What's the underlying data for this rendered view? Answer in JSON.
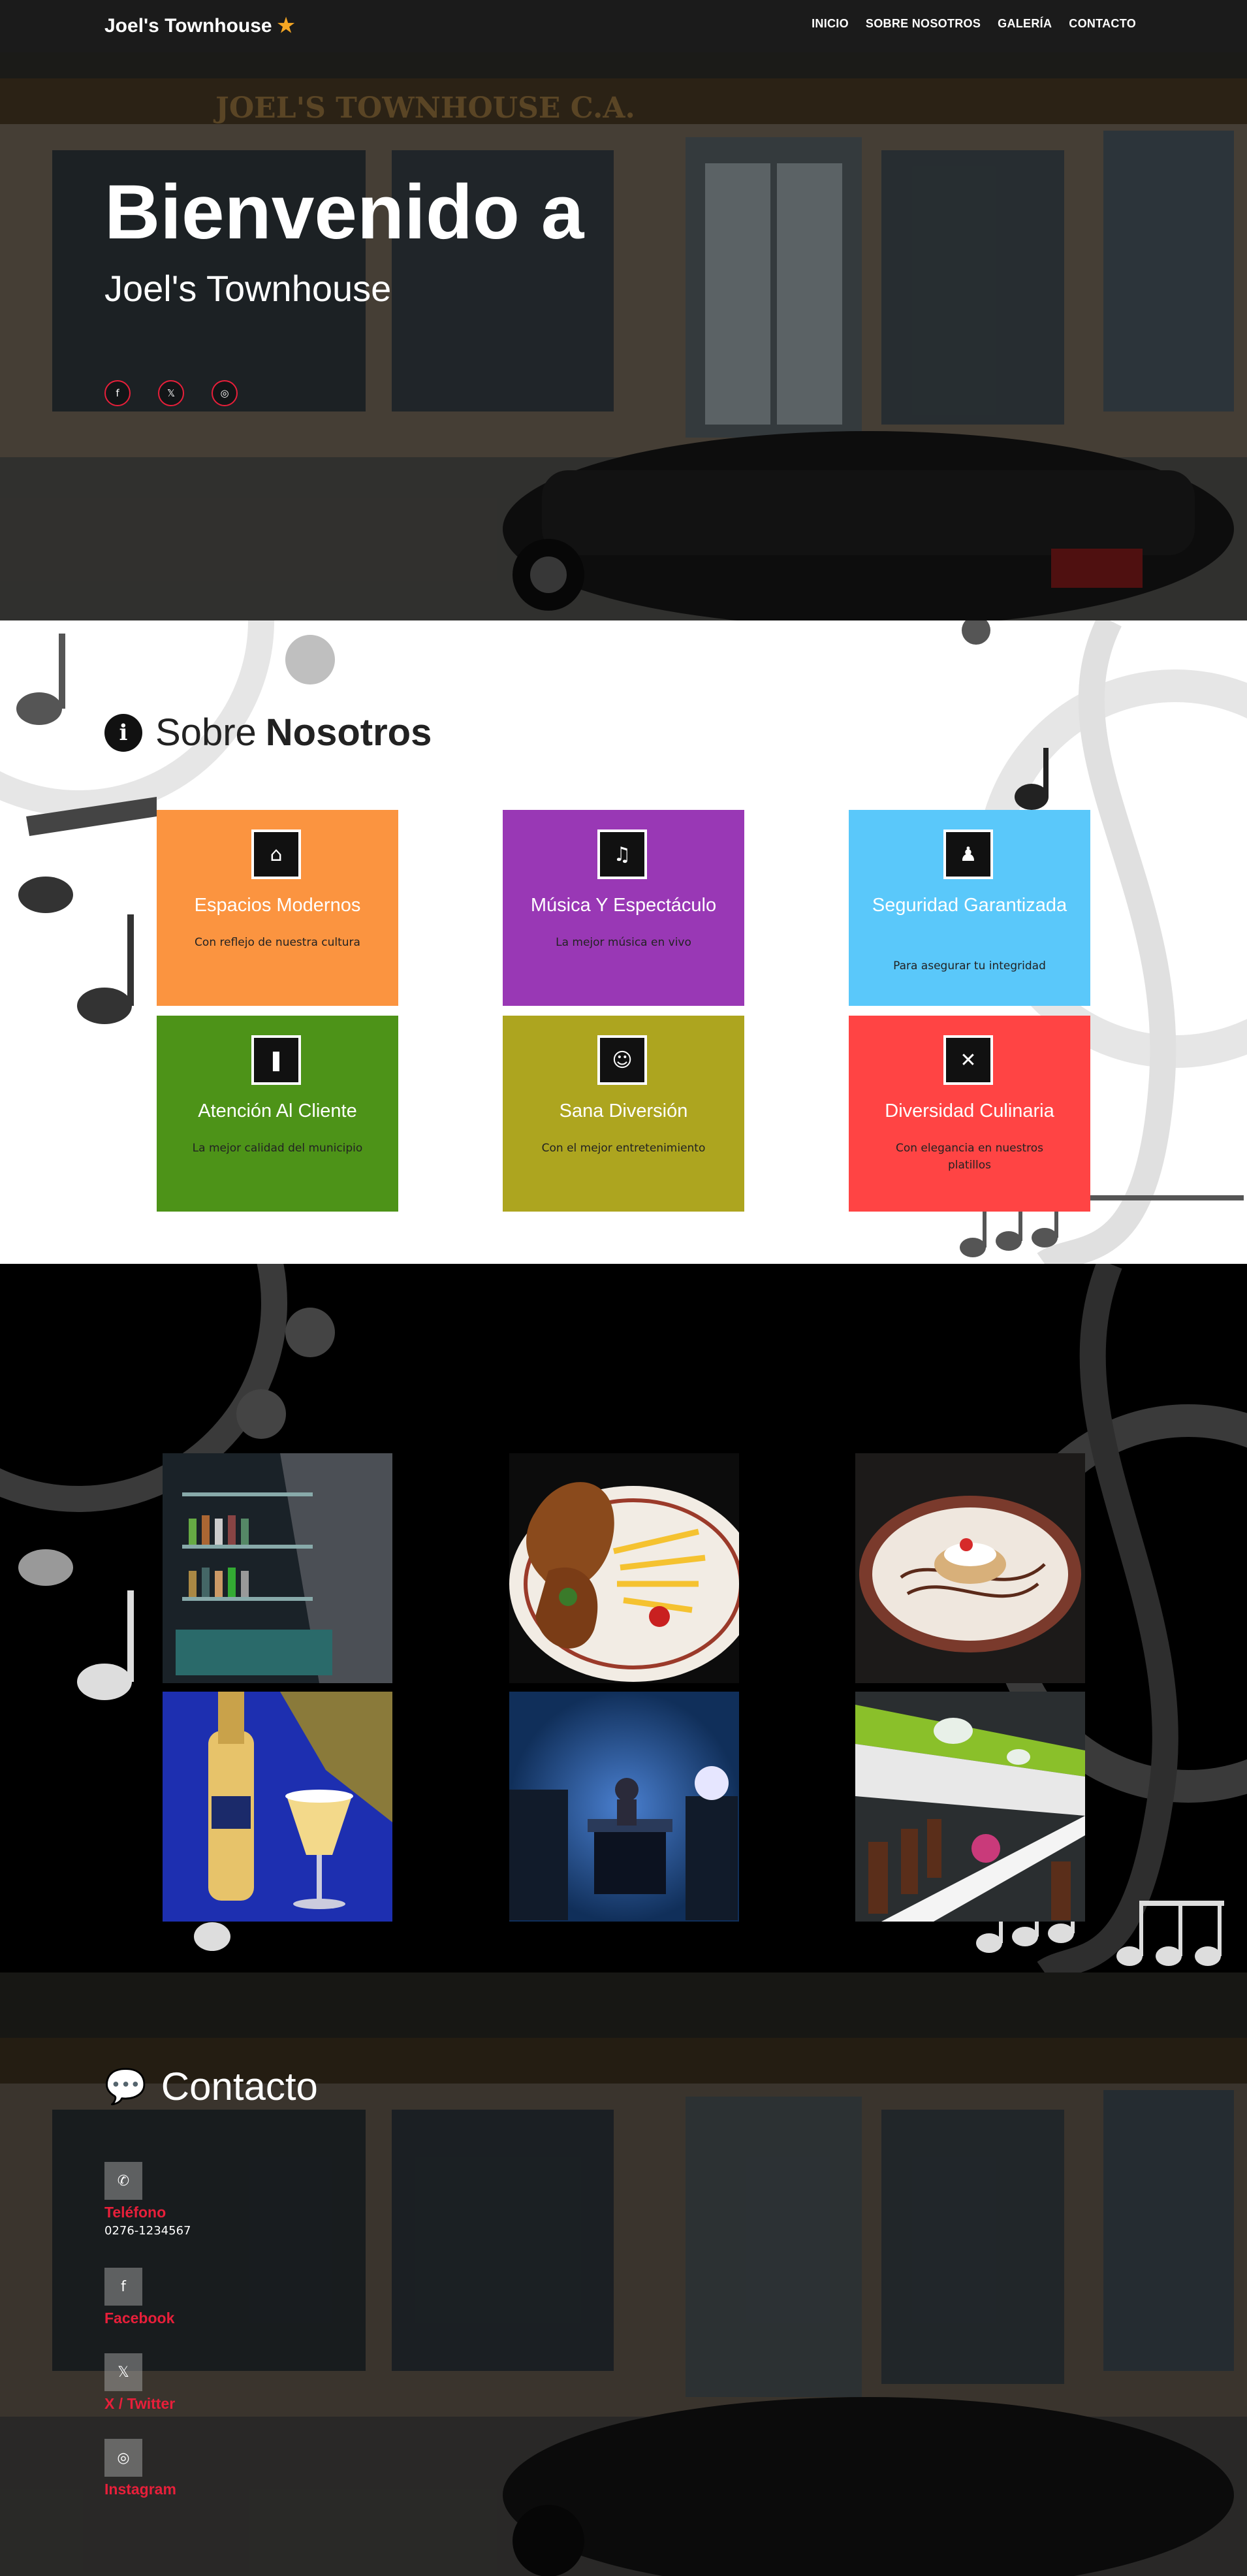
{
  "nav": {
    "brand": "Joel's Townhouse",
    "brand_icon": "star-icon",
    "menu": [
      "INICIO",
      "SOBRE NOSOTROS",
      "GALERÍA",
      "CONTACTO"
    ]
  },
  "hero": {
    "title": "Bienvenido a",
    "subtitle": "Joel's Townhouse",
    "sign_text": "JOEL'S TOWNHOUSE C.A.",
    "socials": [
      {
        "icon": "facebook-icon",
        "glyph": "f"
      },
      {
        "icon": "x-twitter-icon",
        "glyph": "𝕏"
      },
      {
        "icon": "instagram-icon",
        "glyph": "◎"
      }
    ]
  },
  "about": {
    "title_light": "Sobre",
    "title_bold": "Nosotros",
    "cards": [
      {
        "title": "Espacios Modernos",
        "desc": "Con reflejo de nuestra cultura",
        "icon": "home-icon",
        "glyph": "⌂",
        "color": "#fb9440"
      },
      {
        "title": "Música Y Espectáculo",
        "desc": "La mejor música en vivo",
        "icon": "music-icon",
        "glyph": "♫",
        "color": "#9938b5"
      },
      {
        "title": "Seguridad Garantizada",
        "desc": "Para asegurar tu integridad",
        "icon": "person-icon",
        "glyph": "♟",
        "color": "#5ac8fa"
      },
      {
        "title": "Atención Al Cliente",
        "desc": "La mejor calidad del municipio",
        "icon": "bookmark-icon",
        "glyph": "❚",
        "color": "#4d9318"
      },
      {
        "title": "Sana Diversión",
        "desc": "Con el mejor entretenimiento",
        "icon": "group-icon",
        "glyph": "☺",
        "color": "#ada51f"
      },
      {
        "title": "Diversidad Culinaria",
        "desc": "Con elegancia en nuestros platillos",
        "icon": "utensils-icon",
        "glyph": "✕",
        "color": "#ff4444"
      }
    ]
  },
  "gallery": {
    "photos": [
      "bar-shelves-photo",
      "fried-chicken-plate-photo",
      "dessert-plate-photo",
      "drinks-photo",
      "dj-booth-photo",
      "dining-hall-photo"
    ]
  },
  "contact": {
    "title": "Contacto",
    "items": [
      {
        "icon": "phone-icon",
        "glyph": "✆",
        "label": "Teléfono",
        "value": "0276-1234567"
      },
      {
        "icon": "facebook-icon",
        "glyph": "f",
        "label": "Facebook",
        "value": ""
      },
      {
        "icon": "x-twitter-icon",
        "glyph": "𝕏",
        "label": "X / Twitter",
        "value": ""
      },
      {
        "icon": "instagram-icon",
        "glyph": "◎",
        "label": "Instagram",
        "value": ""
      }
    ]
  }
}
